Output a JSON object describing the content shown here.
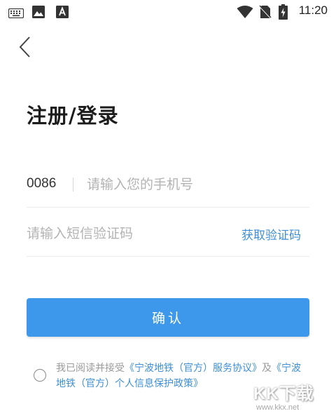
{
  "status_bar": {
    "time": "11:20",
    "icons": [
      "keyboard-icon",
      "image-icon",
      "font-icon",
      "wifi-icon",
      "no-sim-icon",
      "battery-charging-icon"
    ]
  },
  "header": {
    "back_icon": "chevron-left-icon"
  },
  "page": {
    "title": "注册/登录"
  },
  "form": {
    "country_code": "0086",
    "phone_placeholder": "请输入您的手机号",
    "phone_value": "",
    "code_placeholder": "请输入短信验证码",
    "code_value": "",
    "get_code_label": "获取验证码",
    "confirm_label": "确认"
  },
  "agreement": {
    "prefix": "我已阅读并接受",
    "service_link": "《宁波地铁（官方）服务协议》",
    "joiner": "及",
    "privacy_link": "《宁波地铁（官方）个人信息保护政策》",
    "checked": false
  },
  "watermark": {
    "logo": "KK下载",
    "url": "www.kkx.net"
  },
  "colors": {
    "accent": "#3d98ec",
    "link": "#3e8fd8",
    "placeholder": "#b3b3b3"
  }
}
